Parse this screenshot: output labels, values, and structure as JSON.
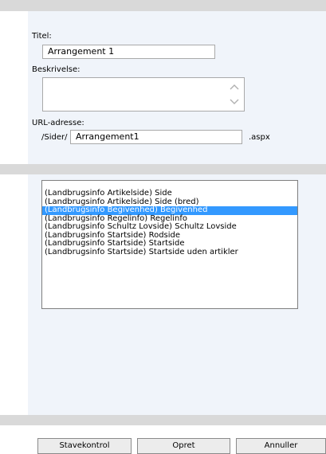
{
  "form": {
    "title_label": "Titel:",
    "title_value": "Arrangement 1",
    "description_label": "Beskrivelse:",
    "description_value": "",
    "url_label": "URL-adresse:",
    "url_prefix": "/Sider/",
    "url_value": "Arrangement1",
    "url_suffix": ".aspx"
  },
  "layout_list": {
    "options": [
      "(Landbrugsinfo Artikelside) Side",
      "(Landbrugsinfo Artikelside) Side (bred)",
      "(Landbrugsinfo Begivenhed) Begivenhed",
      "(Landbrugsinfo Regelinfo) Regelinfo",
      "(Landbrugsinfo Schultz Lovside) Schultz Lovside",
      "(Landbrugsinfo Startside) Rodside",
      "(Landbrugsinfo Startside) Startside",
      "(Landbrugsinfo Startside) Startside uden artikler"
    ],
    "selected": "(Landbrugsinfo Begivenhed) Begivenhed",
    "selected_color": "#3399ff"
  },
  "buttons": {
    "spellcheck": "Stavekontrol",
    "create": "Opret",
    "cancel": "Annuller"
  }
}
